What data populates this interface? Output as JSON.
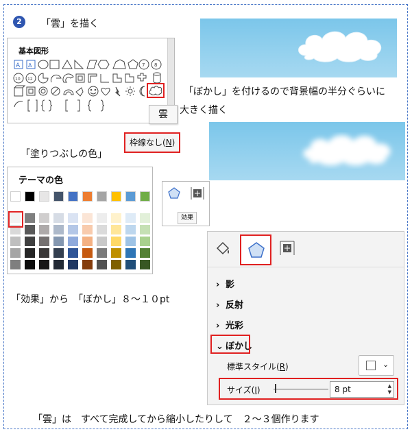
{
  "step_number": "2",
  "step_title": "「雲」を描く",
  "instruction_bokashi_line1": "「ぼかし」を付けるので背景幅の半分ぐらいに",
  "instruction_bokashi_line2": "大きく描く",
  "shapes_panel": {
    "title": "基本図形",
    "cloud_tooltip": "雲"
  },
  "no_outline_prefix": "枠線なし(",
  "no_outline_key": "N",
  "no_outline_suffix": ")",
  "fill_color_label": "「塗りつぶしの色」",
  "theme_colors": {
    "title": "テーマの色",
    "top_row": [
      "#ffffff",
      "#000000",
      "#e7e6e6",
      "#44546a",
      "#4472c4",
      "#ed7d31",
      "#a5a5a5",
      "#ffc000",
      "#5b9bd5",
      "#70ad47"
    ],
    "selected": "#ffffff"
  },
  "effect_tooltip": "効果",
  "effect_instruction": "「効果」から　「ぼかし」８～１０pt",
  "format_panel": {
    "sections": [
      "影",
      "反射",
      "光彩",
      "ぼかし"
    ],
    "standard_style_prefix": "標準スタイル(",
    "standard_style_key": "R",
    "standard_style_suffix": ")",
    "size_prefix": "サイズ(",
    "size_key": "I",
    "size_suffix": ")",
    "size_value": "8 pt",
    "highlight_color": "#e02020"
  },
  "footer_note": "「雲」は　すべて完成してから縮小したりして　２～３個作ります"
}
